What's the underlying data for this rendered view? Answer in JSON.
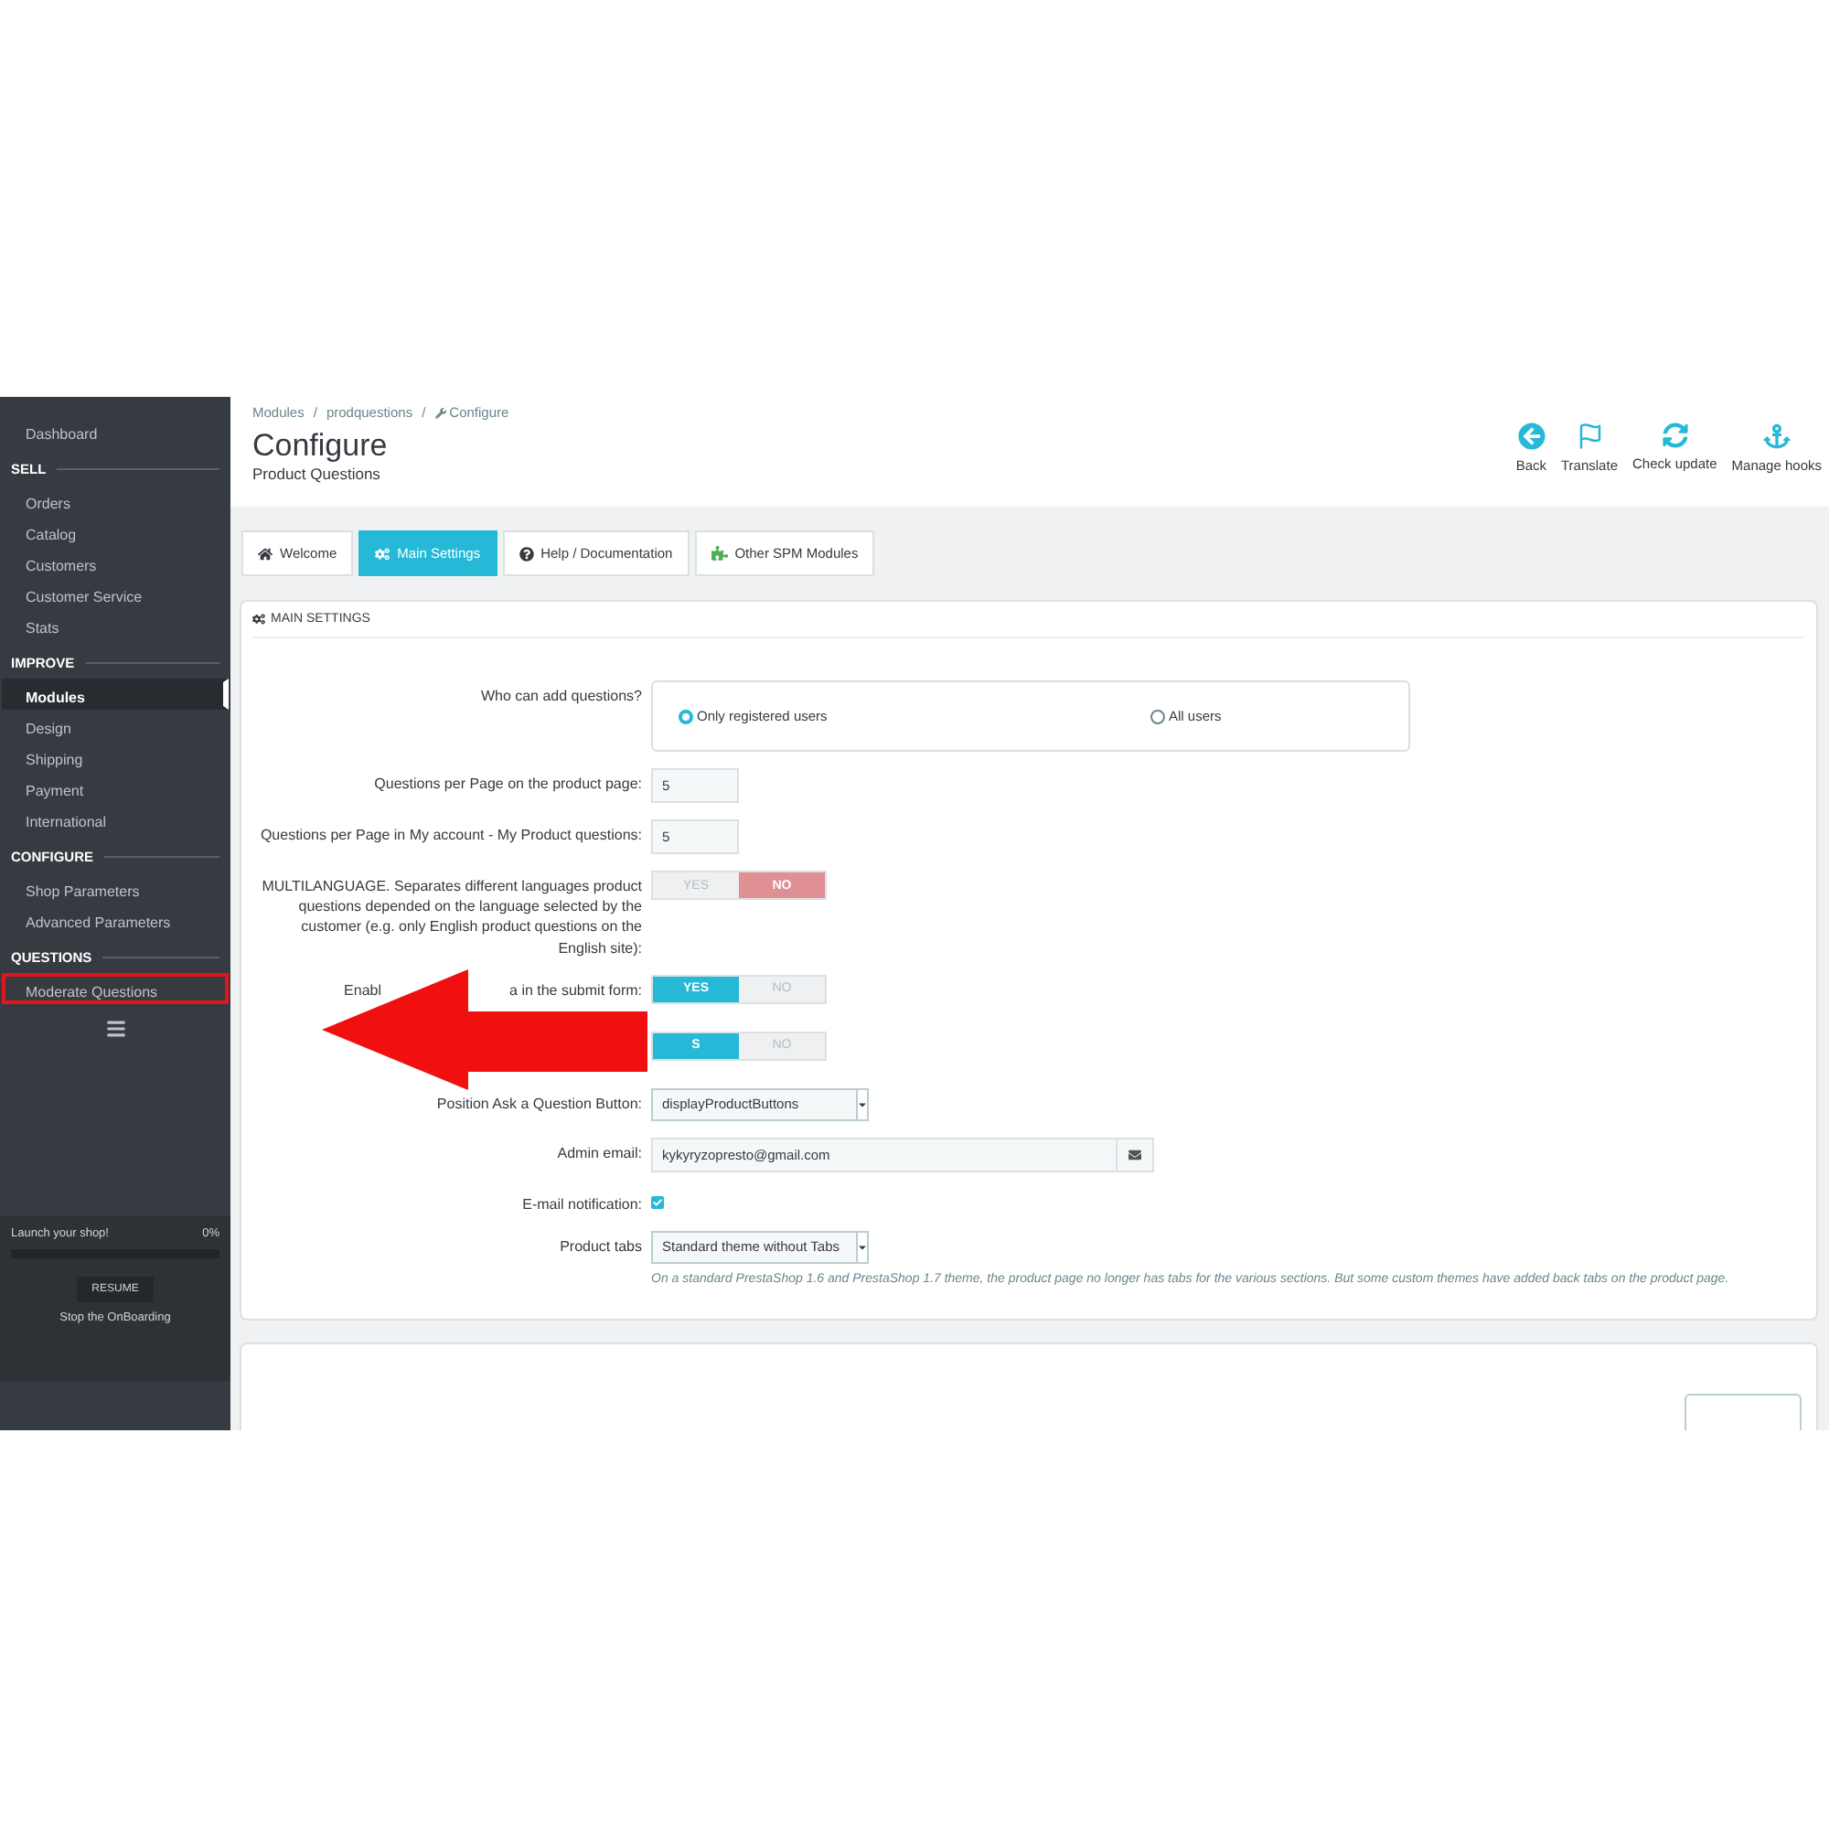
{
  "sidebar": {
    "sections": [
      {
        "items": [
          {
            "label": "Dashboard",
            "selected": false,
            "highlighted": false
          }
        ]
      },
      {
        "heading": "SELL",
        "items": [
          {
            "label": "Orders",
            "selected": false,
            "highlighted": false
          },
          {
            "label": "Catalog",
            "selected": false,
            "highlighted": false
          },
          {
            "label": "Customers",
            "selected": false,
            "highlighted": false
          },
          {
            "label": "Customer Service",
            "selected": false,
            "highlighted": false
          },
          {
            "label": "Stats",
            "selected": false,
            "highlighted": false
          }
        ]
      },
      {
        "heading": "IMPROVE",
        "items": [
          {
            "label": "Modules",
            "selected": true,
            "highlighted": false
          },
          {
            "label": "Design",
            "selected": false,
            "highlighted": false
          },
          {
            "label": "Shipping",
            "selected": false,
            "highlighted": false
          },
          {
            "label": "Payment",
            "selected": false,
            "highlighted": false
          },
          {
            "label": "International",
            "selected": false,
            "highlighted": false
          }
        ]
      },
      {
        "heading": "CONFIGURE",
        "items": [
          {
            "label": "Shop Parameters",
            "selected": false,
            "highlighted": false
          },
          {
            "label": "Advanced Parameters",
            "selected": false,
            "highlighted": false
          }
        ]
      },
      {
        "heading": "QUESTIONS",
        "items": [
          {
            "label": "Moderate Questions",
            "selected": false,
            "highlighted": true
          }
        ]
      }
    ],
    "onboarding": {
      "title": "Launch your shop!",
      "percent": "0%",
      "level": 0,
      "button": "RESUME",
      "link": "Stop the OnBoarding"
    }
  },
  "breadcrumb": [
    "Modules",
    "prodquestions",
    "Configure"
  ],
  "breadcrumb_separator": "/",
  "page_title": "Configure",
  "page_subtitle": "Product Questions",
  "toolbar": [
    {
      "kind": "back",
      "label": "Back"
    },
    {
      "kind": "translate",
      "label": "Translate"
    },
    {
      "kind": "update",
      "label": "Check update"
    },
    {
      "kind": "hooks",
      "label": "Manage hooks"
    }
  ],
  "tabs": [
    {
      "kind": "home",
      "label": "Welcome",
      "selected": false
    },
    {
      "kind": "settings",
      "label": "Main Settings",
      "selected": true
    },
    {
      "kind": "help",
      "label": "Help / Documentation",
      "selected": false
    },
    {
      "kind": "modules",
      "label": "Other SPM Modules",
      "selected": false
    }
  ],
  "panel": {
    "title": "MAIN SETTINGS",
    "rows": [
      {
        "kind": "radio",
        "label": "Who can add questions?",
        "options": [
          {
            "label": "Only registered users",
            "selected": true
          },
          {
            "label": "All users",
            "selected": false
          }
        ]
      },
      {
        "kind": "text",
        "label": "Questions per Page on the product page:",
        "value": "5"
      },
      {
        "kind": "text",
        "label": "Questions per Page in My account - My Product questions:",
        "value": "5"
      },
      {
        "kind": "toggle",
        "label": "MULTILANGUAGE. Separates different languages product questions depended on the language selected by the customer (e.g. only English product questions on the English site):",
        "yes": "YES",
        "no": "NO",
        "on": false
      },
      {
        "kind": "toggle",
        "label": "Enabl",
        "label_after": "a in the submit form:",
        "yes": "YES",
        "no": "NO",
        "on": true
      },
      {
        "kind": "toggle",
        "yes": "S",
        "no": "NO",
        "on": true
      },
      {
        "kind": "select",
        "label": "Position Ask a Question Button:",
        "value": "displayProductButtons"
      },
      {
        "kind": "email",
        "label": "Admin email:",
        "value": "kykyryzopresto@gmail.com"
      },
      {
        "kind": "checkbox",
        "label": "E-mail notification:",
        "checked": true
      },
      {
        "kind": "select",
        "label": "Product tabs",
        "value": "Standard theme without Tabs",
        "help": "On a standard PrestaShop 1.6 and PrestaShop 1.7 theme, the product page no longer has tabs for the various sections. But some custom themes have added back tabs on the product page."
      }
    ]
  }
}
